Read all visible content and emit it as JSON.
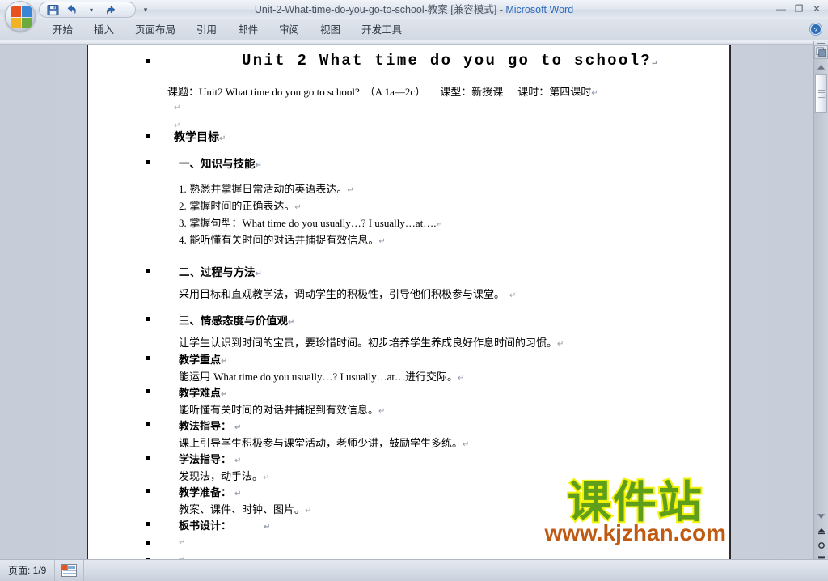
{
  "window": {
    "title_document": "Unit-2-What-time-do-you-go-to-school-教案 [兼容模式] - ",
    "title_app": "Microsoft Word",
    "minimize_label": "—",
    "restore_label": "❐",
    "close_label": "✕"
  },
  "quick_access": {
    "save_label": "save-icon",
    "undo_label": "undo-icon",
    "undo_dropdown_label": "▾",
    "redo_label": "redo-icon",
    "customize_label": "▾"
  },
  "ribbon": {
    "tabs": [
      {
        "label": "开始"
      },
      {
        "label": "插入"
      },
      {
        "label": "页面布局"
      },
      {
        "label": "引用"
      },
      {
        "label": "邮件"
      },
      {
        "label": "审阅"
      },
      {
        "label": "视图"
      },
      {
        "label": "开发工具"
      }
    ],
    "help_label": "?"
  },
  "document": {
    "title": "Unit 2 What time do you go to school?",
    "subtitle_parts": {
      "label1": "课题：",
      "value1": "Unit2 What time do you go to school?",
      "paren": "（A 1a—2c）",
      "label2": "课型：",
      "value2": "新授课",
      "label3": "课时：",
      "value3": "第四课时"
    },
    "sections": [
      {
        "heading": "教学目标"
      },
      {
        "heading": "一、知识与技能"
      },
      {
        "heading": "二、过程与方法",
        "body": "采用目标和直观教学法，调动学生的积极性，引导他们积极参与课堂。"
      },
      {
        "heading": "三、情感态度与价值观",
        "body": "让学生认识到时间的宝贵，要珍惜时间。初步培养学生养成良好作息时间的习惯。"
      },
      {
        "heading": "教学重点",
        "body_pre": "能运用 ",
        "body_en": "What time do you usually…? I usually…at…",
        "body_post": "进行交际。"
      },
      {
        "heading": "教学难点",
        "body": "能听懂有关时间的对话并捕捉到有效信息。"
      },
      {
        "heading": "教法指导：",
        "body": "课上引导学生积极参与课堂活动，老师少讲，鼓励学生多练。"
      },
      {
        "heading": "学法指导：",
        "body": "发现法，动手法。"
      },
      {
        "heading": "教学准备：",
        "body": "教案、课件、时钟、图片。"
      },
      {
        "heading": "板书设计："
      }
    ],
    "skills_list": [
      {
        "num": "1.",
        "text": "熟悉并掌握日常活动的英语表达。"
      },
      {
        "num": "2.",
        "text": "掌握时间的正确表达。"
      },
      {
        "num": "3.",
        "text_pre": "掌握句型：",
        "text_en": "What time do you usually…? I usually…at…."
      },
      {
        "num": "4.",
        "text": "能听懂有关时间的对话并捕捉有效信息。"
      }
    ],
    "pilcrow": "↵"
  },
  "watermark": {
    "brand": "课件站",
    "url": "www.kjzhan.com",
    "brand_color": "#5f9e1b",
    "brand_outline_color": "#f2f20a",
    "url_color": "#c05a12"
  },
  "status_bar": {
    "page_label": "页面: 1/9",
    "doc_icon": "document-icon"
  },
  "scrollbar": {
    "view_ruler_label": "view-ruler-icon",
    "up_label": "▲",
    "down_label": "▼",
    "prev_page_label": "prev-page-icon",
    "select_object_label": "select-browse-object-icon",
    "next_page_label": "next-page-icon"
  }
}
